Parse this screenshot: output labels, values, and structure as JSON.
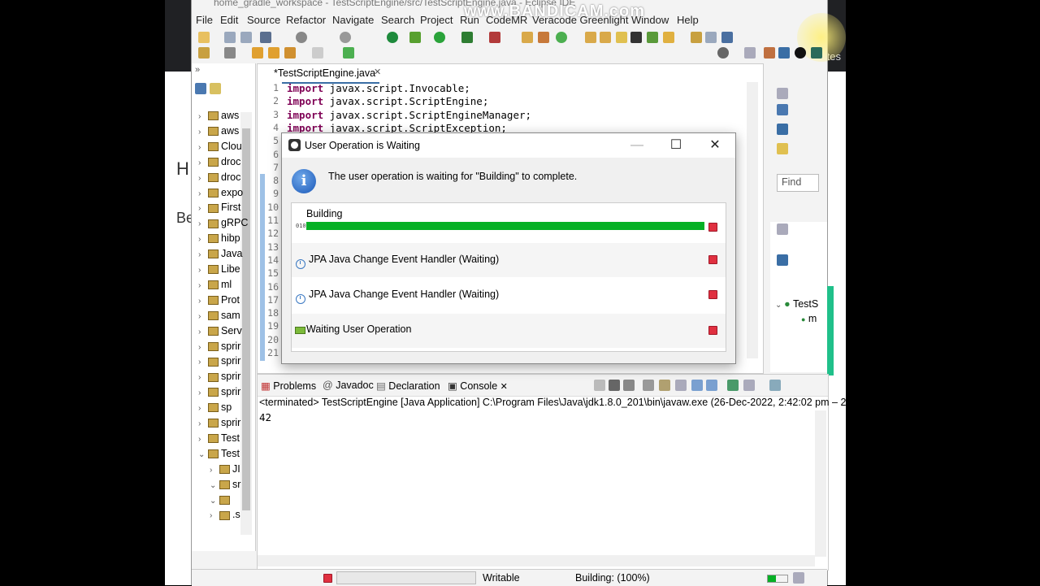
{
  "window": {
    "title": "home_gradle_workspace - TestScriptEngine/src/TestScriptEngine.java - Eclipse IDE",
    "watermark": "www.BANDICAM.com"
  },
  "menu": [
    "File",
    "Edit",
    "Source",
    "Refactor",
    "Navigate",
    "Search",
    "Project",
    "Run",
    "CodeMR",
    "Veracode Greenlight",
    "Window",
    "Help"
  ],
  "background": {
    "left_text": "H",
    "left_text2": "Be",
    "right_text": "tes"
  },
  "package_explorer": {
    "items": [
      {
        "arrow": "›",
        "label": "aws"
      },
      {
        "arrow": "›",
        "label": "aws"
      },
      {
        "arrow": "›",
        "label": "Clou"
      },
      {
        "arrow": "›",
        "label": "droc"
      },
      {
        "arrow": "›",
        "label": "droc"
      },
      {
        "arrow": "›",
        "label": "expo"
      },
      {
        "arrow": "›",
        "label": "First"
      },
      {
        "arrow": "›",
        "label": "gRPC"
      },
      {
        "arrow": "›",
        "label": "hibp"
      },
      {
        "arrow": "›",
        "label": "Java"
      },
      {
        "arrow": "›",
        "label": "Libe"
      },
      {
        "arrow": "›",
        "label": "ml"
      },
      {
        "arrow": "›",
        "label": "Prot"
      },
      {
        "arrow": "›",
        "label": "sam"
      },
      {
        "arrow": "›",
        "label": "Serv"
      },
      {
        "arrow": "›",
        "label": "sprir"
      },
      {
        "arrow": "›",
        "label": "sprir"
      },
      {
        "arrow": "›",
        "label": "sprir"
      },
      {
        "arrow": "›",
        "label": "sprir"
      },
      {
        "arrow": "›",
        "label": "sp"
      },
      {
        "arrow": "›",
        "label": "sprir"
      },
      {
        "arrow": "›",
        "label": "Test"
      },
      {
        "arrow": "⌄",
        "label": "Test"
      },
      {
        "arrow": "›",
        "label": "JI"
      },
      {
        "arrow": "⌄",
        "label": "sr"
      },
      {
        "arrow": "⌄",
        "label": ""
      },
      {
        "arrow": "›",
        "label": ".s"
      }
    ]
  },
  "editor": {
    "tab_label": "*TestScriptEngine.java",
    "code_lines": [
      {
        "n": "1",
        "kw": "import",
        "rest": " javax.script.Invocable;"
      },
      {
        "n": "2",
        "kw": "import",
        "rest": " javax.script.ScriptEngine;"
      },
      {
        "n": "3",
        "kw": "import",
        "rest": " javax.script.ScriptEngineManager;"
      },
      {
        "n": "4",
        "kw": "import",
        "rest": " javax.script.ScriptException;"
      }
    ],
    "more_line_numbers": [
      "5",
      "6",
      "7",
      "8",
      "9",
      "10",
      "11",
      "12",
      "13",
      "14",
      "15",
      "16",
      "17",
      "18",
      "19",
      "20",
      "21"
    ]
  },
  "right_panel": {
    "find_placeholder": "Find",
    "outline_item": "TestS",
    "outline_sub": "m"
  },
  "console": {
    "tabs": [
      "Problems",
      "Javadoc",
      "Declaration",
      "Console"
    ],
    "terminated_line": "<terminated> TestScriptEngine [Java Application] C:\\Program Files\\Java\\jdk1.8.0_201\\bin\\javaw.exe  (26-Dec-2022, 2:42:02 pm – 2",
    "output": "42"
  },
  "status_bar": {
    "writable": "Writable",
    "building": "Building: (100%)"
  },
  "dialog": {
    "title": "User Operation is Waiting",
    "message": "The user operation is waiting for \"Building\" to complete.",
    "jobs": [
      {
        "name": "Building",
        "progress": 1.0
      },
      {
        "name": "JPA Java Change Event Handler (Waiting)"
      },
      {
        "name": "JPA Java Change Event Handler (Waiting)"
      },
      {
        "name": "Waiting User Operation"
      }
    ]
  },
  "colors": {
    "progress_green": "#06b025",
    "stop_red": "#e03040",
    "keyword": "#7f0055"
  }
}
